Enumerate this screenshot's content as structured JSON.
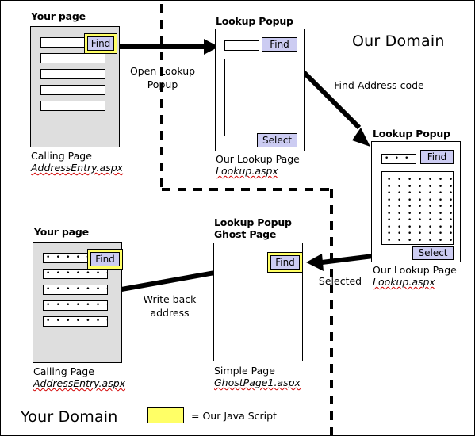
{
  "diagram": {
    "title_our_domain": "Our Domain",
    "title_your_domain": "Your Domain",
    "legend": {
      "swatch_color": "#ffff66",
      "text": "= Our Java Script"
    },
    "colors": {
      "page_shaded": "#dedede",
      "button_face": "#ccccf2",
      "javascript_highlight": "#ffff66",
      "line": "#000000",
      "spell_error_underline": "#d10000"
    }
  },
  "nodes": {
    "calling_page_top": {
      "title": "Your page",
      "caption_line1": "Calling Page",
      "caption_file": "AddressEntry.aspx",
      "button_find": "Find",
      "field_count": 5,
      "fields_filled": false
    },
    "lookup_popup_empty": {
      "title": "Lookup Popup",
      "caption_line1": "Our Lookup Page",
      "caption_file": "Lookup.aspx",
      "button_find": "Find",
      "button_select": "Select",
      "search_value": "",
      "result_rows": []
    },
    "lookup_popup_filled": {
      "title": "Lookup Popup",
      "caption_line1": "Our Lookup Page",
      "caption_file": "Lookup.aspx",
      "button_find": "Find",
      "button_select": "Select",
      "search_value": "• • • •",
      "result_rows": [
        "• • • • • • • • • •",
        "• • • • • • • • • •",
        "• • • • • • • • • •",
        "• • • • • • • • • •",
        "• • • • • • • • • •",
        "• • • • • • • • • •",
        "• • • • • • • • • •",
        "• • • • • • • • • •",
        "• • • • • • • • • •",
        "• • • • • • • • • •"
      ]
    },
    "ghost_page": {
      "title": "Lookup Popup\nGhost Page",
      "caption_line1": "Simple Page",
      "caption_file": "GhostPage1.aspx",
      "button_find": "Find"
    },
    "calling_page_bottom": {
      "title": "Your page",
      "caption_line1": "Calling Page",
      "caption_file": "AddressEntry.aspx",
      "button_find": "Find",
      "field_count": 5,
      "fields_filled": true,
      "field_value": "• • • • • • • •"
    }
  },
  "flows": [
    {
      "id": "open-lookup-popup",
      "label": "Open Lookup\nPopup"
    },
    {
      "id": "find-address-code",
      "label": "Find Address code"
    },
    {
      "id": "selected",
      "label": "Selected"
    },
    {
      "id": "write-back-address",
      "label": "Write back\naddress"
    }
  ]
}
